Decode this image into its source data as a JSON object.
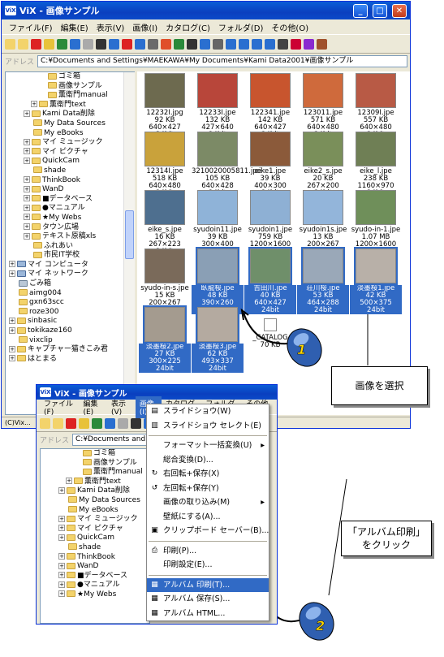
{
  "window1": {
    "title": "ViX - 画像サンプル",
    "app_icon": "ViX",
    "menu": [
      "ファイル(F)",
      "編集(E)",
      "表示(V)",
      "画像(I)",
      "カタログ(C)",
      "フォルダ(D)",
      "その他(O)"
    ],
    "address_label": "アドレス",
    "address": "C:¥Documents and Settings¥MAEKAWA¥My Documents¥Kami Data2001¥画像サンプル",
    "tree": [
      {
        "label": "ゴミ箱",
        "indent": 4,
        "icon": "folder"
      },
      {
        "label": "画像サンプル",
        "indent": 4,
        "icon": "folder"
      },
      {
        "label": "薫衛門manual",
        "indent": 4,
        "icon": "folder"
      },
      {
        "label": "薫衛門text",
        "indent": 3,
        "icon": "folder",
        "plus": true
      },
      {
        "label": "Kami Data削除",
        "indent": 2,
        "icon": "folder",
        "plus": true
      },
      {
        "label": "My Data Sources",
        "indent": 2,
        "icon": "folder"
      },
      {
        "label": "My eBooks",
        "indent": 2,
        "icon": "folder"
      },
      {
        "label": "マイ ミュージック",
        "indent": 2,
        "icon": "folder",
        "plus": true
      },
      {
        "label": "マイ ピクチャ",
        "indent": 2,
        "icon": "folder",
        "plus": true
      },
      {
        "label": "QuickCam",
        "indent": 2,
        "icon": "folder",
        "plus": true
      },
      {
        "label": "shade",
        "indent": 2,
        "icon": "folder"
      },
      {
        "label": "ThinkBook",
        "indent": 2,
        "icon": "folder",
        "plus": true
      },
      {
        "label": "WanD",
        "indent": 2,
        "icon": "folder",
        "plus": true
      },
      {
        "label": "■データベース",
        "indent": 2,
        "icon": "folder",
        "plus": true
      },
      {
        "label": "●マニュアル",
        "indent": 2,
        "icon": "folder",
        "plus": true
      },
      {
        "label": "★My Webs",
        "indent": 2,
        "icon": "folder",
        "plus": true
      },
      {
        "label": "タウン広場",
        "indent": 2,
        "icon": "folder",
        "plus": true
      },
      {
        "label": "テキスト原稿xls",
        "indent": 2,
        "icon": "folder",
        "plus": true
      },
      {
        "label": "ふれあい",
        "indent": 2,
        "icon": "folder"
      },
      {
        "label": "市民IT学校",
        "indent": 2,
        "icon": "folder"
      },
      {
        "label": "マイ コンピュータ",
        "indent": 0,
        "icon": "pc",
        "plus": true
      },
      {
        "label": "マイ ネットワーク",
        "indent": 0,
        "icon": "pc",
        "plus": true
      },
      {
        "label": "ごみ箱",
        "indent": 0,
        "icon": "trash"
      },
      {
        "label": "aimg004",
        "indent": 0,
        "icon": "folder"
      },
      {
        "label": "gxn63scc",
        "indent": 0,
        "icon": "folder"
      },
      {
        "label": "roze300",
        "indent": 0,
        "icon": "folder"
      },
      {
        "label": "sinbasic",
        "indent": 0,
        "icon": "folder",
        "plus": true
      },
      {
        "label": "tokikaze160",
        "indent": 0,
        "icon": "folder",
        "plus": true
      },
      {
        "label": "vixclip",
        "indent": 0,
        "icon": "folder"
      },
      {
        "label": "キャプチャー猫きこみ君",
        "indent": 0,
        "icon": "folder",
        "plus": true
      },
      {
        "label": "はとまる",
        "indent": 0,
        "icon": "folder",
        "plus": true
      }
    ],
    "thumbs": [
      {
        "name": "12232I.jpg",
        "size": "92 KB",
        "dims": "640×427",
        "depth": "24bit",
        "color": "#6d6a4f",
        "sel": false
      },
      {
        "name": "12233I.jpe",
        "size": "132 KB",
        "dims": "427×640",
        "depth": "24bit",
        "color": "#b8463a",
        "sel": false
      },
      {
        "name": "122341.jpe",
        "size": "142 KB",
        "dims": "640×427",
        "depth": "24bit",
        "color": "#c8552e",
        "sel": false
      },
      {
        "name": "123011.jpe",
        "size": "571 KB",
        "dims": "640×480",
        "depth": "24bit",
        "color": "#cf6a3c",
        "sel": false
      },
      {
        "name": "12309I.jpe",
        "size": "557 KB",
        "dims": "640×480",
        "depth": "24bit",
        "color": "#b85a45",
        "sel": false
      },
      {
        "name": "12314I.jpe",
        "size": "518 KB",
        "dims": "640×480",
        "depth": "24bit",
        "color": "#c9a23b",
        "sel": false
      },
      {
        "name": "3210020005811.jpe",
        "size": "105 KB",
        "dims": "640×428",
        "depth": "24bit",
        "color": "#7c8a66",
        "sel": false
      },
      {
        "name": "eike1.jpe",
        "size": "39 KB",
        "dims": "400×300",
        "depth": "24bit",
        "color": "#8b5a3a",
        "sel": false
      },
      {
        "name": "eike2_s.jpe",
        "size": "20 KB",
        "dims": "267×200",
        "depth": "24bit",
        "color": "#7a8f5a",
        "sel": false
      },
      {
        "name": "eike_l.jpe",
        "size": "238 KB",
        "dims": "1160×970",
        "depth": "24bit",
        "color": "#6f7f55",
        "sel": false
      },
      {
        "name": "eike_s.jpe",
        "size": "16 KB",
        "dims": "267×223",
        "depth": "24bit",
        "color": "#4e6f8f",
        "sel": false
      },
      {
        "name": "syudoin11.jpe",
        "size": "39 KB",
        "dims": "300×400",
        "depth": "24bit",
        "color": "#8fb3d8",
        "sel": false
      },
      {
        "name": "syudoin1.jpe",
        "size": "759 KB",
        "dims": "1200×1600",
        "depth": "24bit",
        "color": "#8eb0d4",
        "sel": false
      },
      {
        "name": "syudoin1s.jpe",
        "size": "13 KB",
        "dims": "200×267",
        "depth": "24bit",
        "color": "#93b5da",
        "sel": false
      },
      {
        "name": "syudo-in-1.jpe",
        "size": "1.07 MB",
        "dims": "1200×1600",
        "depth": "24bit",
        "color": "#6f8f5a",
        "sel": false
      },
      {
        "name": "syudo-in-s.jpe",
        "size": "15 KB",
        "dims": "200×267",
        "depth": "24bit",
        "color": "#7a6a5a",
        "sel": false
      },
      {
        "name": "臥龍桜.jpe",
        "size": "48 KB",
        "dims": "390×260",
        "depth": "24bit",
        "color": "#8a9fb5",
        "sel": true
      },
      {
        "name": "吉田川.jpe",
        "size": "40 KB",
        "dims": "640×427",
        "depth": "24bit",
        "color": "#6f8f6a",
        "sel": true
      },
      {
        "name": "荘川桜.jpe",
        "size": "53 KB",
        "dims": "464×288",
        "depth": "24bit",
        "color": "#9aa8b8",
        "sel": true
      },
      {
        "name": "淡墨桜1.jpe",
        "size": "42 KB",
        "dims": "500×375",
        "depth": "24bit",
        "color": "#b8b0a8",
        "sel": true
      },
      {
        "name": "淡墨桜2.jpe",
        "size": "27 KB",
        "dims": "300×225",
        "depth": "24bit",
        "color": "#a49b8f",
        "sel": true
      },
      {
        "name": "淡墨桜3.jpe",
        "size": "62 KB",
        "dims": "493×337",
        "depth": "24bit",
        "color": "#b4aaa0",
        "sel": true
      },
      {
        "name": "_CATALOG",
        "size": "70 KB",
        "dims": "",
        "depth": "",
        "color": "#ffffff",
        "sel": false
      }
    ],
    "status": "(C)Vix..."
  },
  "callout1": "画像を選択",
  "callout2_line1": "「アルバム印刷」",
  "callout2_line2": "をクリック",
  "mouse1_label": "1",
  "mouse2_label": "2",
  "window2": {
    "title": "ViX - 画像サンプル",
    "app_icon": "ViX",
    "menu": [
      "ファイル(F)",
      "編集(E)",
      "表示(V)",
      "画像(I)",
      "カタログ(C)",
      "フォルダ(D)",
      "その他(O)"
    ],
    "active_menu_index": 3,
    "address_label": "アドレス",
    "address": "C:¥Documents and Settings¥",
    "tree": [
      {
        "label": "ゴミ箱",
        "indent": 4,
        "icon": "folder"
      },
      {
        "label": "画像サンプル",
        "indent": 4,
        "icon": "folder"
      },
      {
        "label": "薫衛門manual",
        "indent": 4,
        "icon": "folder"
      },
      {
        "label": "薫衛門text",
        "indent": 3,
        "icon": "folder",
        "plus": true
      },
      {
        "label": "Kami Data削除",
        "indent": 2,
        "icon": "folder",
        "plus": true
      },
      {
        "label": "My Data Sources",
        "indent": 2,
        "icon": "folder"
      },
      {
        "label": "My eBooks",
        "indent": 2,
        "icon": "folder"
      },
      {
        "label": "マイ ミュージック",
        "indent": 2,
        "icon": "folder",
        "plus": true
      },
      {
        "label": "マイ ピクチャ",
        "indent": 2,
        "icon": "folder",
        "plus": true
      },
      {
        "label": "QuickCam",
        "indent": 2,
        "icon": "folder",
        "plus": true
      },
      {
        "label": "shade",
        "indent": 2,
        "icon": "folder"
      },
      {
        "label": "ThinkBook",
        "indent": 2,
        "icon": "folder",
        "plus": true
      },
      {
        "label": "WanD",
        "indent": 2,
        "icon": "folder",
        "plus": true
      },
      {
        "label": "■データベース",
        "indent": 2,
        "icon": "folder",
        "plus": true
      },
      {
        "label": "●マニュアル",
        "indent": 2,
        "icon": "folder",
        "plus": true
      },
      {
        "label": "★My Webs",
        "indent": 2,
        "icon": "folder",
        "plus": true
      }
    ],
    "menu_items": [
      {
        "label": "スライドショウ(W)",
        "icon": "slideshow-icon",
        "glyph": "▤"
      },
      {
        "label": "スライドショウ セレクト(E)",
        "icon": "slideshow-select-icon",
        "glyph": "▥"
      },
      {
        "sep": true
      },
      {
        "label": "フォーマット一括変換(U)",
        "arrow": true
      },
      {
        "label": "総合変換(D)..."
      },
      {
        "label": "右回転+保存(X)",
        "icon": "rotate-right-icon",
        "glyph": "↻"
      },
      {
        "label": "左回転+保存(Y)",
        "icon": "rotate-left-icon",
        "glyph": "↺"
      },
      {
        "label": "画像の取り込み(M)",
        "arrow": true
      },
      {
        "label": "壁紙にする(A)..."
      },
      {
        "label": "クリップボード セーバー(B)...",
        "icon": "clipboard-icon",
        "glyph": "▣"
      },
      {
        "sep": true
      },
      {
        "label": "印刷(P)...",
        "icon": "print-icon",
        "glyph": "⎙"
      },
      {
        "label": "印刷設定(E)..."
      },
      {
        "sep": true
      },
      {
        "label": "アルバム 印刷(T)...",
        "icon": "album-print-icon",
        "glyph": "▦",
        "hl": true
      },
      {
        "label": "アルバム 保存(S)...",
        "icon": "album-save-icon",
        "glyph": "▦"
      },
      {
        "label": "アルバム HTML...",
        "icon": "album-html-icon",
        "glyph": "▦"
      }
    ]
  },
  "colors": {
    "titlebar": "#0a3fbf",
    "highlight": "#316ac5",
    "mouse": "#2f5fb0"
  }
}
